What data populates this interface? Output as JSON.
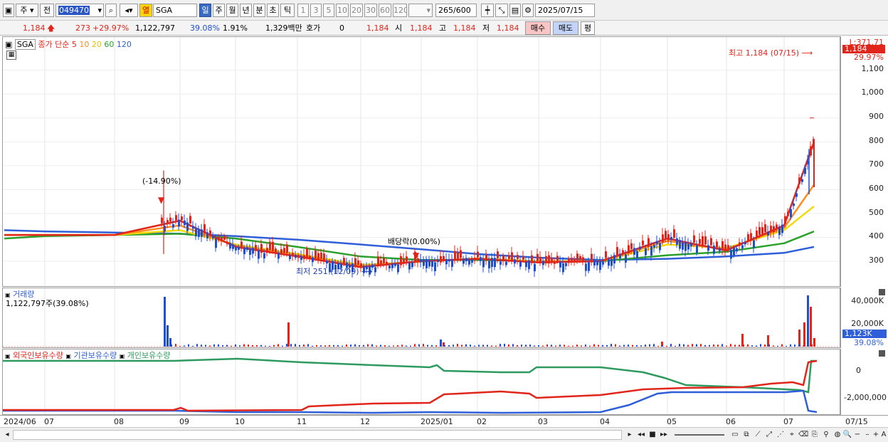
{
  "toolbar": {
    "period_value": "주",
    "prev_label": "전",
    "code": "049470",
    "color_tag": "열",
    "stock_name": "SGA",
    "periods": [
      "일",
      "주",
      "월",
      "년",
      "분",
      "초",
      "틱"
    ],
    "active_period": "일",
    "intervals": [
      "1",
      "3",
      "5",
      "10",
      "20",
      "30",
      "60",
      "120"
    ],
    "count": "265",
    "count_total": "/600",
    "date": "2025/07/15"
  },
  "info": {
    "price": "1,184",
    "change": "273",
    "change_pct": "+29.97%",
    "volume": "1,122,797",
    "volume_pct": "39.08%",
    "turnover": "1.91%",
    "amount": "1,329백만",
    "quote_label": "호가",
    "quote_value": "0",
    "quote_price": "1,184",
    "open_label": "시",
    "open": "1,184",
    "high_label": "고",
    "high": "1,184",
    "low_label": "저",
    "low": "1,184",
    "buy_label": "매수",
    "sell_label": "매도",
    "eval_label": "평"
  },
  "price_pane": {
    "name_tag": "SGA",
    "legend_title": "종가 단순",
    "ma_periods": [
      "5",
      "10",
      "20",
      "60",
      "120"
    ],
    "y_ticks": [
      "1,100",
      "1,000",
      "900",
      "800",
      "700",
      "600",
      "500",
      "400",
      "300"
    ],
    "axis_top_text": "L:371.71",
    "last_price_box": "1,184",
    "last_pct": "29.97%",
    "high_annotation": "최고 1,184 (07/15)",
    "low_annotation": "최저 251 (12/09)",
    "drop_annotation": "(-14.90%)",
    "dividend_annotation": "배당락(0.00%)"
  },
  "volume_pane": {
    "title": "거래량",
    "subtitle": "1,122,797주(39.08%)",
    "y_ticks": [
      "40,000K",
      "20,000K"
    ],
    "last_box": "1,123K",
    "last_pct": "39.08%"
  },
  "holding_pane": {
    "legend": [
      "외국인보유수량",
      "기관보유수량",
      "개인보유수량"
    ],
    "y_ticks": [
      "0",
      "-2,000,000"
    ]
  },
  "x_axis": [
    "2024/06",
    "07",
    "08",
    "09",
    "10",
    "11",
    "12",
    "2025/01",
    "02",
    "03",
    "04",
    "05",
    "06",
    "07",
    "07/15"
  ],
  "colors": {
    "up": "#e1251b",
    "down": "#1f4fd0",
    "ma5": "#e1251b",
    "ma10": "#ff8c1a",
    "ma20": "#f5d90a",
    "ma60": "#2ca02c",
    "ma120": "#2f5fd8",
    "foreign": "#e1251b",
    "institution": "#2f5fd8",
    "individual": "#2e9a5f"
  },
  "chart_data": {
    "type": "line",
    "x": [
      "2024/06",
      "07",
      "08",
      "09",
      "10",
      "11",
      "12",
      "2025/01",
      "02",
      "03",
      "04",
      "05",
      "06",
      "07",
      "07/15"
    ],
    "y_range": [
      250,
      1180
    ],
    "series": [
      {
        "name": "5",
        "values": [
          410,
          410,
          410,
          470,
          360,
          320,
          275,
          300,
          310,
          295,
          300,
          395,
          345,
          450,
          800
        ]
      },
      {
        "name": "10",
        "values": [
          410,
          410,
          410,
          450,
          365,
          325,
          280,
          300,
          310,
          298,
          300,
          385,
          350,
          440,
          620
        ]
      },
      {
        "name": "20",
        "values": [
          410,
          410,
          410,
          430,
          370,
          330,
          285,
          298,
          312,
          300,
          300,
          370,
          355,
          430,
          530
        ]
      },
      {
        "name": "60",
        "values": [
          395,
          405,
          410,
          415,
          395,
          360,
          320,
          305,
          305,
          300,
          300,
          325,
          340,
          375,
          425
        ]
      },
      {
        "name": "120",
        "values": [
          430,
          425,
          420,
          415,
          405,
          390,
          370,
          350,
          330,
          315,
          305,
          310,
          320,
          335,
          360
        ]
      }
    ]
  }
}
